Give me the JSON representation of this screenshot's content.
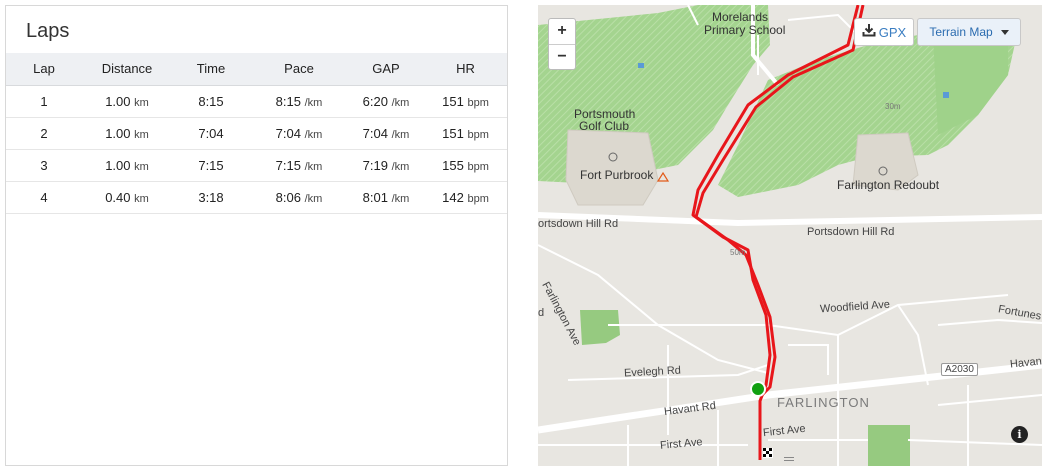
{
  "laps": {
    "title": "Laps",
    "columns": [
      "Lap",
      "Distance",
      "Time",
      "Pace",
      "GAP",
      "HR"
    ],
    "rows": [
      {
        "lap": "1",
        "distance": "1.00",
        "distance_unit": "km",
        "time": "8:15",
        "pace": "8:15",
        "pace_unit": "/km",
        "gap": "6:20",
        "gap_unit": "/km",
        "hr": "151",
        "hr_unit": "bpm"
      },
      {
        "lap": "2",
        "distance": "1.00",
        "distance_unit": "km",
        "time": "7:04",
        "pace": "7:04",
        "pace_unit": "/km",
        "gap": "7:04",
        "gap_unit": "/km",
        "hr": "151",
        "hr_unit": "bpm"
      },
      {
        "lap": "3",
        "distance": "1.00",
        "distance_unit": "km",
        "time": "7:15",
        "pace": "7:15",
        "pace_unit": "/km",
        "gap": "7:19",
        "gap_unit": "/km",
        "hr": "155",
        "hr_unit": "bpm"
      },
      {
        "lap": "4",
        "distance": "0.40",
        "distance_unit": "km",
        "time": "3:18",
        "pace": "8:06",
        "pace_unit": "/km",
        "gap": "8:01",
        "gap_unit": "/km",
        "hr": "142",
        "hr_unit": "bpm"
      }
    ]
  },
  "map": {
    "controls": {
      "zoom_in": "+",
      "zoom_out": "−",
      "gpx_label": "GPX",
      "map_type_label": "Terrain Map",
      "info_label": "i"
    },
    "labels": {
      "primary_school_1": "Morelands",
      "primary_school_2": "Primary School",
      "golf_1": "Portsmouth",
      "golf_2": "Golf Club",
      "fort_purbrook": "Fort Purbrook",
      "farlington_redoubt": "Farlington Redoubt",
      "portsdown_left": "ortsdown Hill Rd",
      "portsdown_right": "Portsdown Hill Rd",
      "farlington_ave": "Farlington Ave",
      "woodfield": "Woodfield Ave",
      "fortunes": "Fortunes",
      "evelegh": "Evelegh Rd",
      "havant_rd": "Havant Rd",
      "havant_right": "Havan",
      "a2030": "A2030",
      "farlington_town": "FARLINGTON",
      "first_ave_left": "First Ave",
      "first_ave_right": "First Ave",
      "contour_30": "30m",
      "contour_50": "50m",
      "edge_d": "d"
    },
    "colors": {
      "route": "#e8161b",
      "golf_green": "#9fd28a",
      "start_marker": "#12a012"
    }
  }
}
